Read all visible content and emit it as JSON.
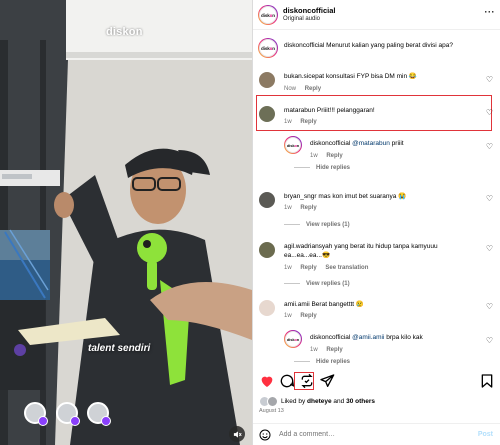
{
  "video": {
    "watermark": "diskon",
    "caption": "talent sendiri",
    "tagged_count": 3,
    "mute_icon": "speaker-muted-icon"
  },
  "header": {
    "username": "diskoncofficial",
    "audio": "Original audio",
    "logo_text_a": "disk",
    "logo_text_b": "o",
    "logo_text_c": "n",
    "more": "···"
  },
  "comments": [
    {
      "id": "c0",
      "user": "diskoncofficial",
      "text": "Menurut kalian yang paling berat divisi apa?"
    },
    {
      "id": "c1",
      "user": "bukan.sicepat",
      "text": "konsultasi FYP bisa DM min 😂",
      "time": "Now",
      "reply": "Reply"
    },
    {
      "id": "c2",
      "user": "matarabun",
      "text": "Priiit!!! pelanggaran!",
      "time": "1w",
      "reply": "Reply"
    },
    {
      "id": "c3",
      "user": "diskoncofficial",
      "mention": "@matarabun",
      "text": "priiit",
      "time": "1w",
      "reply": "Reply",
      "hide": "Hide replies"
    },
    {
      "id": "c4",
      "user": "bryan_sngr",
      "text": "mas kon imut bet suaranya 😭",
      "time": "1w",
      "reply": "Reply",
      "view": "View replies (1)"
    },
    {
      "id": "c5",
      "user": "agil.wadriansyah",
      "text_line1": "yang berat itu hidup tanpa kamyuuu",
      "text_line2": "ea...ea...ea...😎",
      "time": "1w",
      "reply": "Reply",
      "translate": "See translation",
      "view": "View replies (1)"
    },
    {
      "id": "c6",
      "user": "amii.amii",
      "text": "Berat bangetttt 😢",
      "time": "1w",
      "reply": "Reply"
    },
    {
      "id": "c7",
      "user": "diskoncofficial",
      "mention": "@amii.amii",
      "text": "brpa kilo kak",
      "time": "1w",
      "reply": "Reply",
      "hide": "Hide replies"
    }
  ],
  "actions": {
    "like_icon": "heart-filled-icon",
    "comment_icon": "comment-icon",
    "repost_icon": "repost-icon",
    "share_icon": "send-icon",
    "save_icon": "bookmark-icon"
  },
  "likes": {
    "prefix": "Liked by",
    "user": "dheteye",
    "and": "and",
    "others": "30 others"
  },
  "date": "August 13",
  "add_comment": {
    "placeholder": "Add a comment…",
    "post": "Post"
  },
  "colors": {
    "like_red": "#ff3040",
    "highlight_red": "#e0343a",
    "link_blue": "#00376b",
    "post_blue": "#b2dffc"
  }
}
